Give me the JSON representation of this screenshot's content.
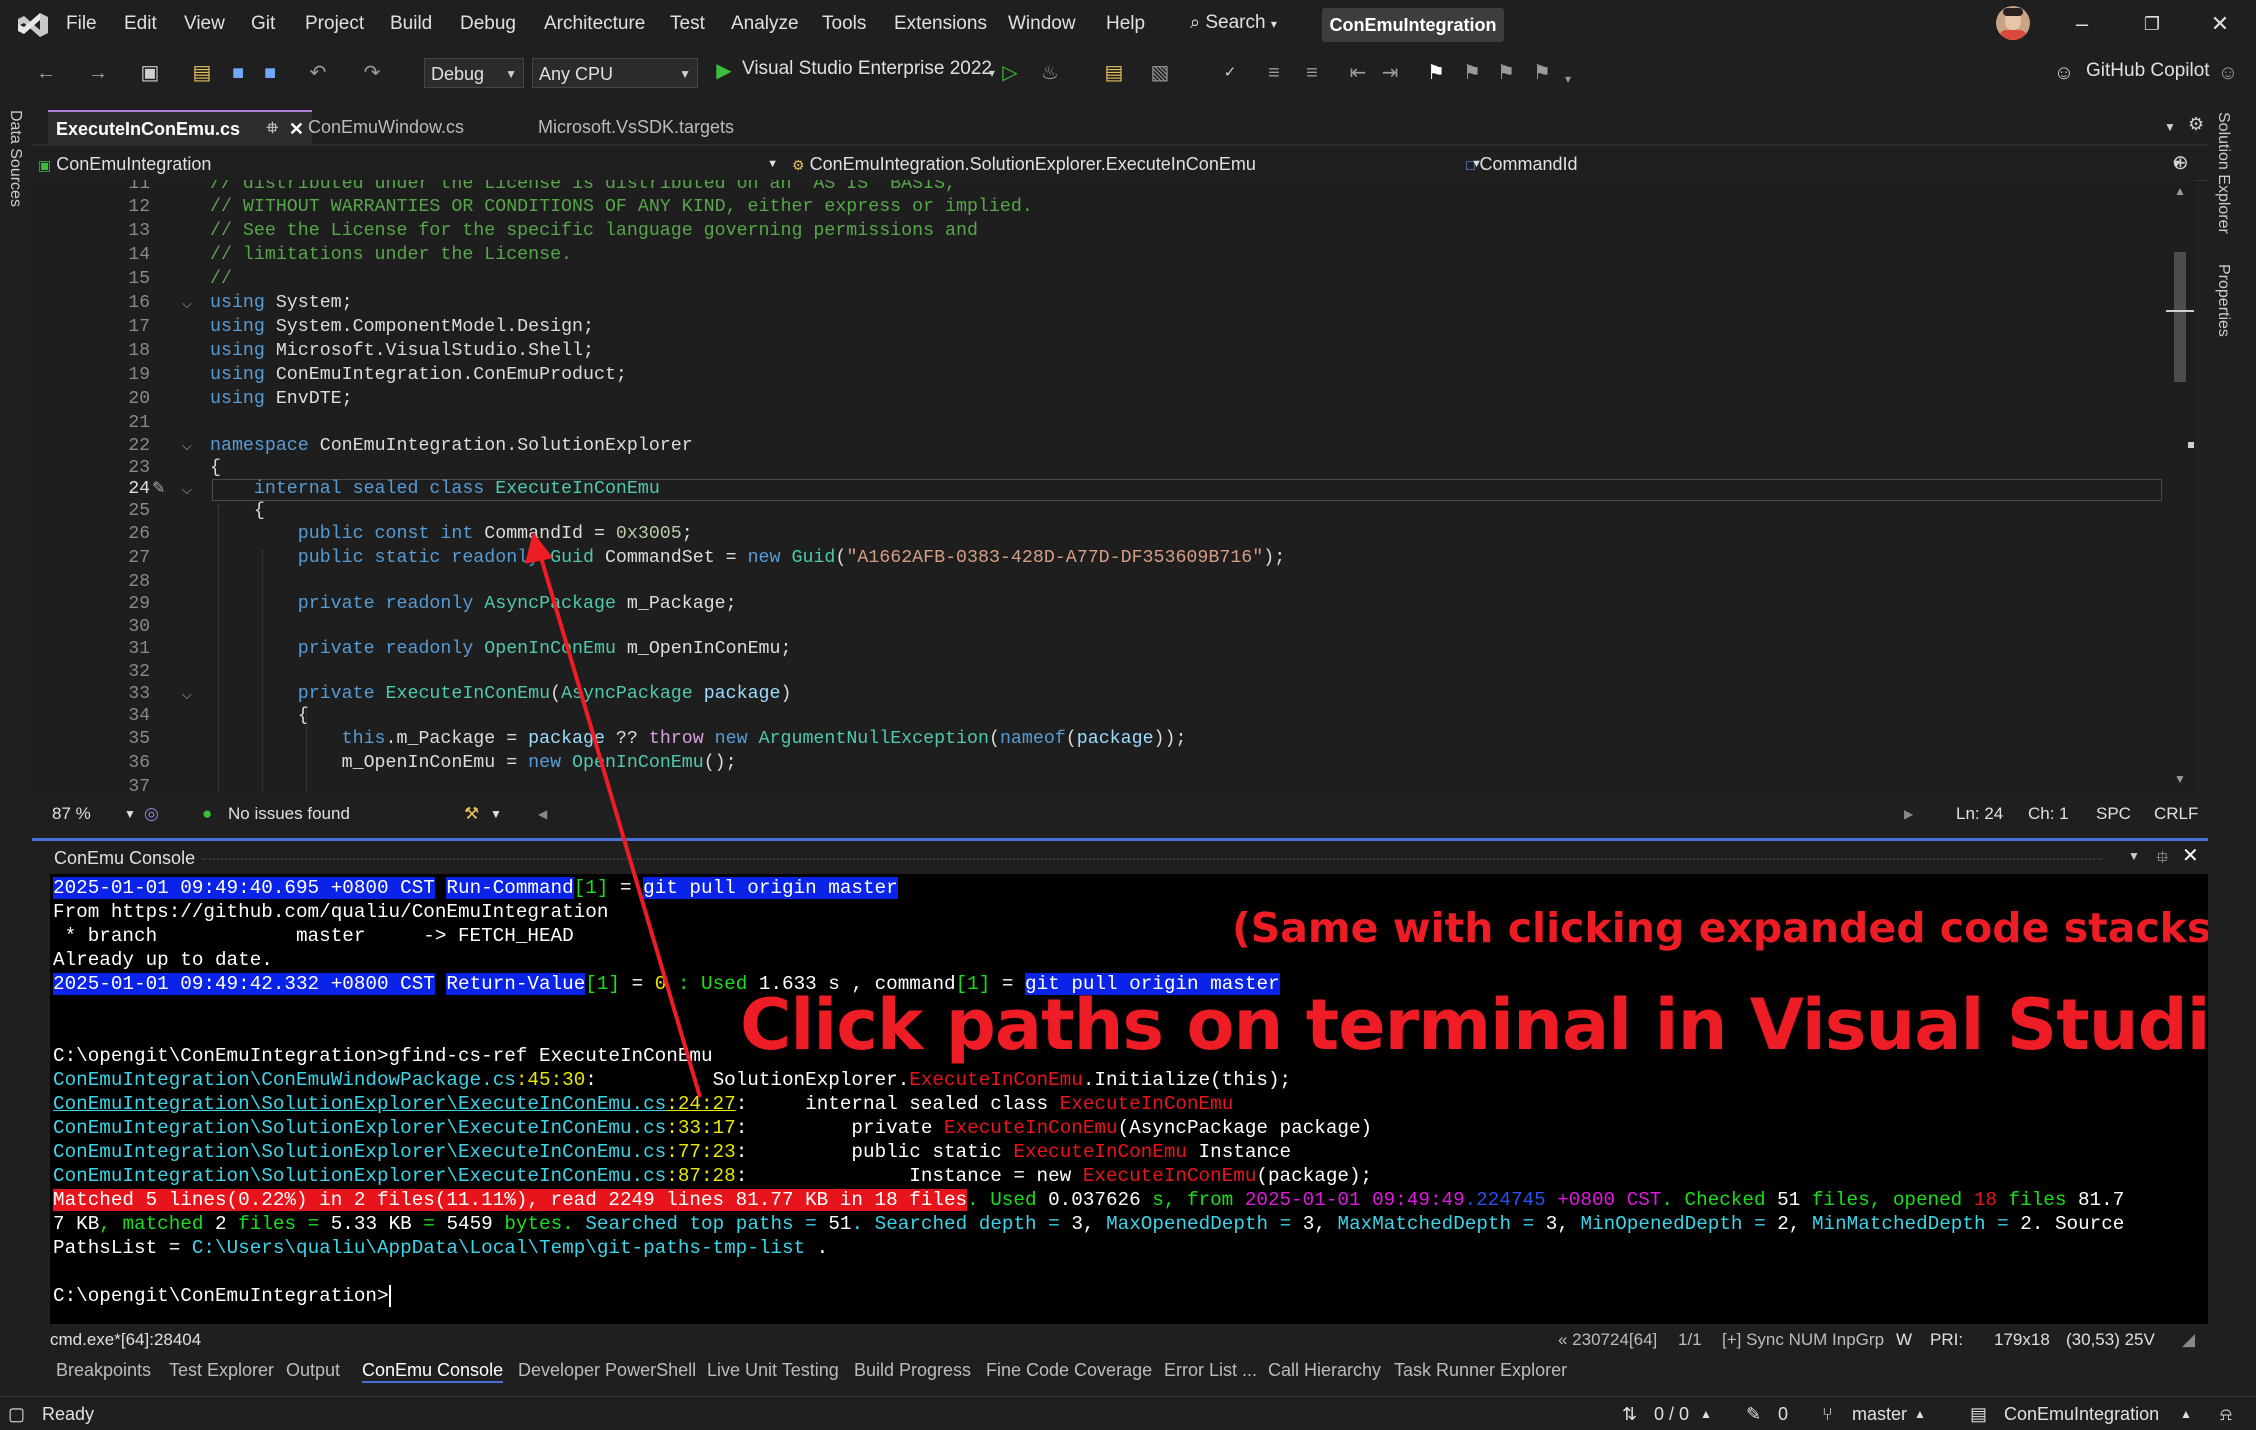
{
  "menu": [
    "File",
    "Edit",
    "View",
    "Git",
    "Project",
    "Build",
    "Debug",
    "Architecture",
    "Test",
    "Analyze",
    "Tools",
    "Extensions",
    "Window",
    "Help"
  ],
  "search_label": "Search",
  "solution_title": "ConEmuIntegration",
  "toolbar": {
    "config": "Debug",
    "platform": "Any CPU",
    "run_target": "Visual Studio Enterprise 2022",
    "copilot": "GitHub Copilot"
  },
  "side": {
    "left": "Data Sources",
    "right_top": "Solution Explorer",
    "right_bottom": "Properties"
  },
  "tabs": [
    {
      "label": "ExecuteInConEmu.cs",
      "active": true
    },
    {
      "label": "ConEmuWindow.cs",
      "active": false
    },
    {
      "label": "Microsoft.VsSDK.targets",
      "active": false
    }
  ],
  "navbar": {
    "project": "ConEmuIntegration",
    "type": "ConEmuIntegration.SolutionExplorer.ExecuteInConEmu",
    "member": "CommandId"
  },
  "editor": {
    "line_numbers": [
      "11",
      "12",
      "13",
      "14",
      "15",
      "16",
      "17",
      "18",
      "19",
      "20",
      "21",
      "22",
      "23",
      "24",
      "25",
      "26",
      "27",
      "28",
      "29",
      "30",
      "31",
      "32",
      "33",
      "34",
      "35",
      "36",
      "37"
    ],
    "current_line": "24",
    "lines": [
      {
        "t": "// distributed under the License is distributed on an \"AS IS\" BASIS,"
      },
      {
        "t": "// WITHOUT WARRANTIES OR CONDITIONS OF ANY KIND, either express or implied."
      },
      {
        "t": "// See the License for the specific language governing permissions and"
      },
      {
        "t": "// limitations under the License."
      },
      {
        "t": "//"
      },
      {
        "kw": "using",
        "rest": " System;"
      },
      {
        "kw": "using",
        "rest": " System.ComponentModel.Design;"
      },
      {
        "kw": "using",
        "rest": " Microsoft.VisualStudio.Shell;"
      },
      {
        "kw": "using",
        "rest": " ConEmuIntegration.ConEmuProduct;"
      },
      {
        "kw": "using",
        "rest": " EnvDTE;"
      },
      {
        "t": ""
      },
      {
        "kw": "namespace",
        "rest": " ConEmuIntegration.SolutionExplorer"
      },
      {
        "t": "{"
      },
      {
        "kw": "    internal sealed class",
        "type": " ExecuteInConEmu"
      },
      {
        "t": "    {"
      },
      {
        "kw": "        public const int",
        "rest": " CommandId = ",
        "num": "0x3005",
        "end": ";"
      },
      {
        "kw": "        public static readonly",
        "type": " Guid",
        "rest": " CommandSet = ",
        "kw2": "new",
        "type2": " Guid",
        "str_open": "(",
        "str": "\"A1662AFB-0383-428D-A77D-DF353609B716\"",
        "end": ");"
      },
      {
        "t": ""
      },
      {
        "kw": "        private readonly",
        "type": " AsyncPackage",
        "rest": " m_Package;"
      },
      {
        "t": ""
      },
      {
        "kw": "        private readonly",
        "type": " OpenInConEmu",
        "rest": " m_OpenInConEmu;"
      },
      {
        "t": ""
      },
      {
        "kw": "        private",
        "type": " ExecuteInConEmu",
        "rest": "(",
        "type2": "AsyncPackage",
        "id": " package",
        "end": ")"
      },
      {
        "t": "        {"
      },
      {
        "kw": "            this",
        "rest": ".m_Package = ",
        "id": "package",
        "rest2": " ?? ",
        "ctl": "throw",
        "kw2": " new",
        "type2": " ArgumentNullException",
        "rest3": "(",
        "kw3": "nameof",
        "rest4": "(",
        "id2": "package",
        "end": "));"
      },
      {
        "rest": "            m_OpenInConEmu = ",
        "kw": "new",
        "type": " OpenInConEmu",
        "rest2": "();"
      },
      {
        "t": ""
      }
    ]
  },
  "editor_status": {
    "zoom": "87 %",
    "issues": "No issues found",
    "ln": "Ln: 24",
    "ch": "Ch: 1",
    "spc": "SPC",
    "crlf": "CRLF"
  },
  "conemu": {
    "title": "ConEmu Console",
    "log1_ts": "2025-01-01 09:49:40.695 +0800 CST",
    "log1_cmd": "Run-Command",
    "log1_idx": "[1]",
    "log1_eq": " = ",
    "log1_val": "git pull origin master",
    "from_line": "From https://github.com/qualiu/ConEmuIntegration",
    "branch_line": " * branch            master     -> FETCH_HEAD",
    "uptodate": "Already up to date.",
    "log2_ts": "2025-01-01 09:49:42.332 +0800 CST",
    "log2_cmd": "Return-Value",
    "log2_idx": "[1]",
    "log2_eq": " = ",
    "log2_zero": "0",
    "log2_used": " : Used ",
    "log2_sec": "1.633",
    "log2_mid": " s , command",
    "log2_idx2": "[1]",
    "log2_eq2": " = ",
    "log2_val": "git pull origin master",
    "prompt1": "C:\\opengit\\ConEmuIntegration>gfind-cs-ref ExecuteInConEmu",
    "results": [
      {
        "dir": "ConEmuIntegration\\",
        "file": "ConEmuWindowPackage.cs",
        "pos": "45:30",
        "pad": ":          ",
        "pre": "SolutionExplorer.",
        "hit": "ExecuteInConEmu",
        "post": ".Initialize(this);",
        "link": false
      },
      {
        "dir": "ConEmuIntegration\\SolutionExplorer\\",
        "file": "ExecuteInConEmu.cs",
        "pos": "24:27",
        "pad": ":     ",
        "pre": "internal sealed class ",
        "hit": "ExecuteInConEmu",
        "post": "",
        "link": true
      },
      {
        "dir": "ConEmuIntegration\\SolutionExplorer\\",
        "file": "ExecuteInConEmu.cs",
        "pos": "33:17",
        "pad": ":         ",
        "pre": "private ",
        "hit": "ExecuteInConEmu",
        "post": "(AsyncPackage package)",
        "link": false
      },
      {
        "dir": "ConEmuIntegration\\SolutionExplorer\\",
        "file": "ExecuteInConEmu.cs",
        "pos": "77:23",
        "pad": ":         ",
        "pre": "public static ",
        "hit": "ExecuteInConEmu",
        "post": " Instance",
        "link": false
      },
      {
        "dir": "ConEmuIntegration\\SolutionExplorer\\",
        "file": "ExecuteInConEmu.cs",
        "pos": "87:28",
        "pad": ":              ",
        "pre": "Instance = new ",
        "hit": "ExecuteInConEmu",
        "post": "(package);",
        "link": false
      }
    ],
    "summary_red": "Matched 5 lines(0.22%) in 2 files(11.11%), read 2249 lines 81.77 KB in 18 files",
    "summary_a": ". Used ",
    "summary_sec": "0.037626",
    "summary_b": " s, from ",
    "summary_date": "2025-01-01 09:49:49",
    "summary_frac": ".224745",
    "summary_tz": " +0800 CST",
    "summary_c": ". Checked ",
    "summary_checked": "51",
    "summary_files": " files",
    "summary_d": ", opened ",
    "summary_opened": "18",
    "summary_e": " files ",
    "summary_kb": "81.7",
    "line2_a": "7 KB",
    "line2_b": ", matched ",
    "line2_matched": "2",
    "line2_c": " files = ",
    "line2_kb": "5.33 KB",
    "line2_d": " = ",
    "line2_bytes": "5459",
    "line2_e": " bytes. ",
    "line2_f": "Searched top paths = ",
    "line2_top": "51",
    "line2_g": ". ",
    "line2_h": "Searched depth = ",
    "line2_depth": "3",
    "line2_i": ", ",
    "line2_j": "MaxOpenedDepth = ",
    "line2_maxo": "3",
    "line2_k": ", ",
    "line2_l": "MaxMatchedDepth = ",
    "line2_maxm": "3",
    "line2_m": ", ",
    "line2_n": "MinOpenedDepth = ",
    "line2_mino": "2",
    "line2_o": ", ",
    "line2_p": "MinMatchedDepth = ",
    "line2_minm": "2",
    "line2_q": ". Source",
    "line3_a": "PathsList = ",
    "line3_path": "C:\\Users\\qualiu\\AppData\\Local\\Temp\\git-paths-tmp-list",
    "line3_b": " .",
    "prompt2": "C:\\opengit\\ConEmuIntegration>",
    "annotation_small": "(Same with clicking expanded code stacks)",
    "annotation_big": "Click paths on terminal in Visual Studio"
  },
  "conemu_status": {
    "left": "cmd.exe*[64]:28404",
    "build": "« 230724[64]",
    "page": "1/1",
    "mode": "[+] Sync NUM InpGrp",
    "w": "W",
    "pri": "PRI:",
    "size": "179x18",
    "cursor": "(30,53) 25V"
  },
  "tooltabs": [
    {
      "label": "Breakpoints",
      "active": false
    },
    {
      "label": "Test Explorer",
      "active": false
    },
    {
      "label": "Output",
      "active": false
    },
    {
      "label": "ConEmu Console",
      "active": true
    },
    {
      "label": "Developer PowerShell",
      "active": false
    },
    {
      "label": "Live Unit Testing",
      "active": false
    },
    {
      "label": "Build Progress",
      "active": false
    },
    {
      "label": "Fine Code Coverage",
      "active": false
    },
    {
      "label": "Error List ...",
      "active": false
    },
    {
      "label": "Call Hierarchy",
      "active": false
    },
    {
      "label": "Task Runner Explorer",
      "active": false
    }
  ],
  "statusbar": {
    "ready": "Ready",
    "git_sync": "0 / 0",
    "edits": "0",
    "branch": "master",
    "repo": "ConEmuIntegration"
  },
  "colors": {
    "accent": "#ad7fd6",
    "annotation": "#ee1c24",
    "console_blue": "#0a23e8",
    "console_red": "#e8141c"
  }
}
